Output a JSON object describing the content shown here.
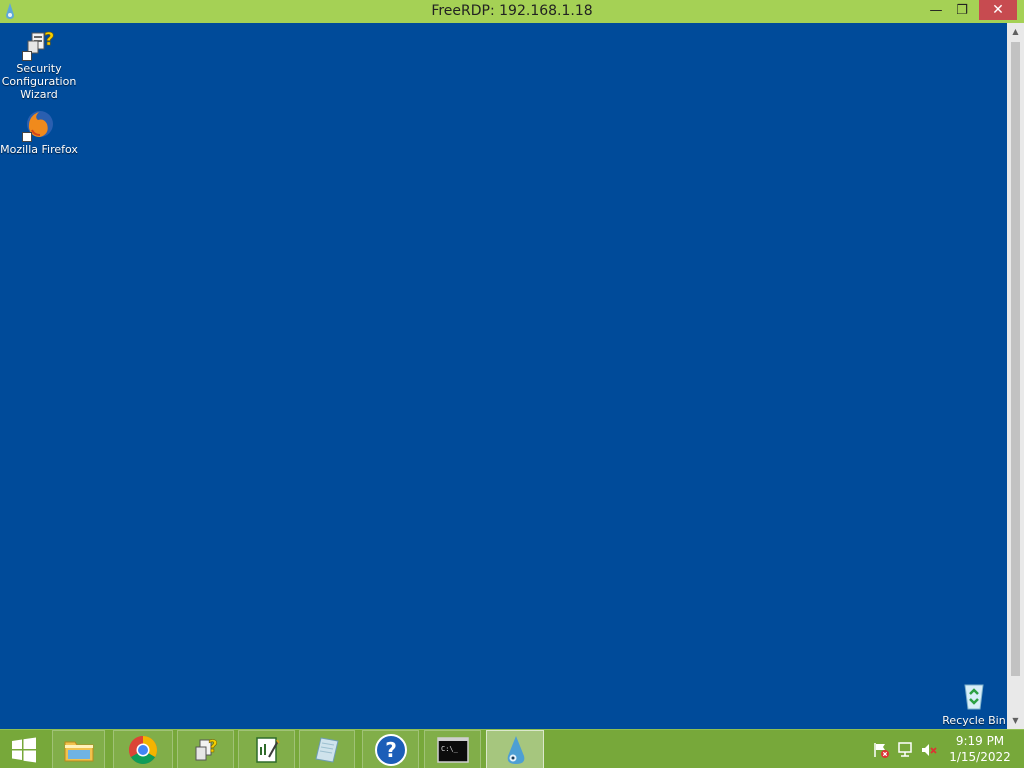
{
  "window": {
    "title": "FreeRDP: 192.168.1.18",
    "minimize_glyph": "—",
    "restore_glyph": "❐",
    "close_glyph": "✕"
  },
  "desktop": {
    "background_color": "#004b9a",
    "icons": [
      {
        "label": "Security\nConfiguration\nWizard",
        "icon": "security-wizard-icon"
      },
      {
        "label": "Mozilla Firefox",
        "icon": "firefox-icon"
      },
      {
        "label": "Recycle Bin",
        "icon": "recycle-bin-icon"
      }
    ]
  },
  "taskbar": {
    "color": "#77a83a",
    "apps": [
      {
        "icon": "start-windows-icon"
      },
      {
        "icon": "file-explorer-icon"
      },
      {
        "icon": "chrome-icon"
      },
      {
        "icon": "security-wizard-icon"
      },
      {
        "icon": "notepad-icon"
      },
      {
        "icon": "paper-icon"
      },
      {
        "icon": "help-icon"
      },
      {
        "icon": "command-prompt-icon"
      },
      {
        "icon": "freerdp-icon",
        "active": true
      }
    ],
    "cmd_text": "C:\\_",
    "help_glyph": "?",
    "tray_icons": [
      "action-center-flag-icon",
      "network-icon",
      "volume-muted-icon"
    ],
    "time": "9:19 PM",
    "date": "1/15/2022"
  },
  "scrollbar": {
    "up_glyph": "▲",
    "down_glyph": "▼"
  }
}
